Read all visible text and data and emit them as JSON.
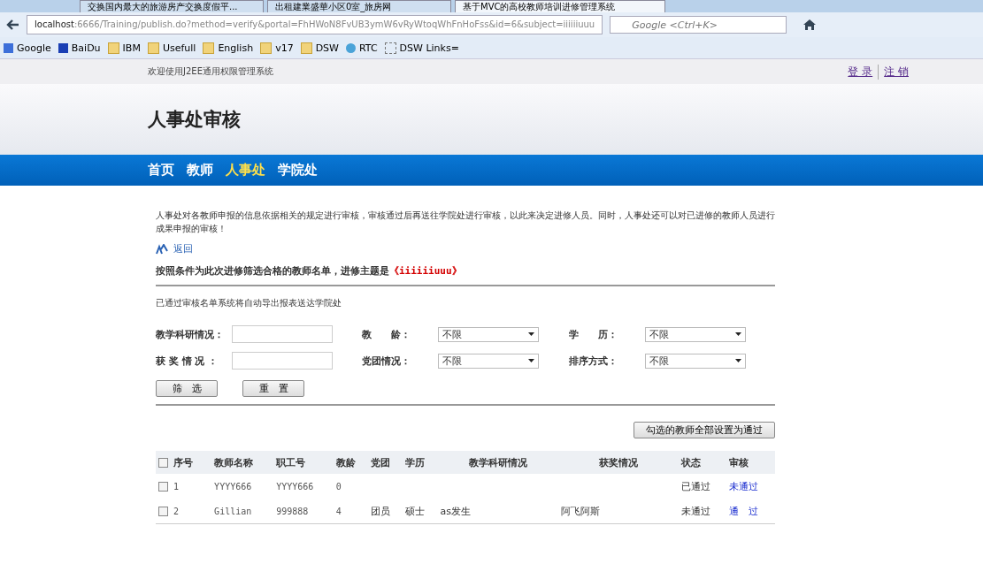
{
  "browser": {
    "tabs": [
      {
        "title": "交换国内最大的旅游房产交换度假平...",
        "selected": false
      },
      {
        "title": "出租建業盛華小区0室_旅房网",
        "selected": false
      },
      {
        "title": "基于MVC的高校教师培训进修管理系统",
        "selected": true
      }
    ],
    "address": {
      "host": "localhost",
      "rest": ":6666/Training/publish.do?method=verify&portal=FhHWoN8FvUB3ymW6vRyWtoqWhFnHoFss&id=6&subject=iiiiiiuuu"
    },
    "search": {
      "placeholder": "Google <Ctrl+K>"
    },
    "bookmarks": [
      {
        "label": "Google",
        "kind": "google"
      },
      {
        "label": "BaiDu",
        "kind": "paw"
      },
      {
        "label": "IBM",
        "kind": "folder"
      },
      {
        "label": "Usefull",
        "kind": "folder"
      },
      {
        "label": "English",
        "kind": "folder"
      },
      {
        "label": "v17",
        "kind": "folder"
      },
      {
        "label": "DSW",
        "kind": "folder"
      },
      {
        "label": "RTC",
        "kind": "globe"
      },
      {
        "label": "DSW Links=",
        "kind": "page"
      }
    ]
  },
  "topbar": {
    "welcome": "欢迎使用J2EE通用权限管理系统",
    "links": [
      "登 录",
      "注 销"
    ]
  },
  "page_title": "人事处审核",
  "nav": [
    {
      "label": "首页",
      "selected": false
    },
    {
      "label": "教师",
      "selected": false
    },
    {
      "label": "人事处",
      "selected": true
    },
    {
      "label": "学院处",
      "selected": false
    }
  ],
  "intro": "人事处对各教师申报的信息依据相关的规定进行审核，审核通过后再送往学院处进行审核，以此来决定进修人员。同时，人事处还可以对已进修的教师人员进行成果申报的审核！",
  "back_link": "返回",
  "heading": {
    "text": "按照条件为此次进修筛选合格的教师名单，进修主题是",
    "subject": "《iiiiiiuuu》"
  },
  "note": "已通过审核名单系统将自动导出报表送达学院处",
  "filters": [
    {
      "label": "教学科研情况：",
      "kind": "text"
    },
    {
      "label": "教　　龄：",
      "kind": "select",
      "value": "不限"
    },
    {
      "label": "学　　历：",
      "kind": "select",
      "value": "不限"
    },
    {
      "label": "获 奖 情 况 ：",
      "kind": "text"
    },
    {
      "label": "党团情况：",
      "kind": "select",
      "value": "不限"
    },
    {
      "label": "排序方式：",
      "kind": "select",
      "value": "不限"
    }
  ],
  "filter_buttons": [
    "筛　选",
    "重　置"
  ],
  "approve_all": "勾选的教师全部设置为通过",
  "table": {
    "select_all": false,
    "columns": [
      "序号",
      "教师名称",
      "职工号",
      "教龄",
      "党团",
      "学历",
      "教学科研情况",
      "获奖情况",
      "状态",
      "审核"
    ],
    "rows": [
      {
        "checked": false,
        "cells": [
          "1",
          "YYYY666",
          "YYYY666",
          "0",
          "",
          "",
          "",
          "",
          "已通过",
          "未通过"
        ]
      },
      {
        "checked": false,
        "cells": [
          "2",
          "Gillian",
          "999888",
          "4",
          "团员",
          "硕士",
          "as发生",
          "阿飞阿斯",
          "未通过",
          "通　过"
        ]
      }
    ]
  }
}
